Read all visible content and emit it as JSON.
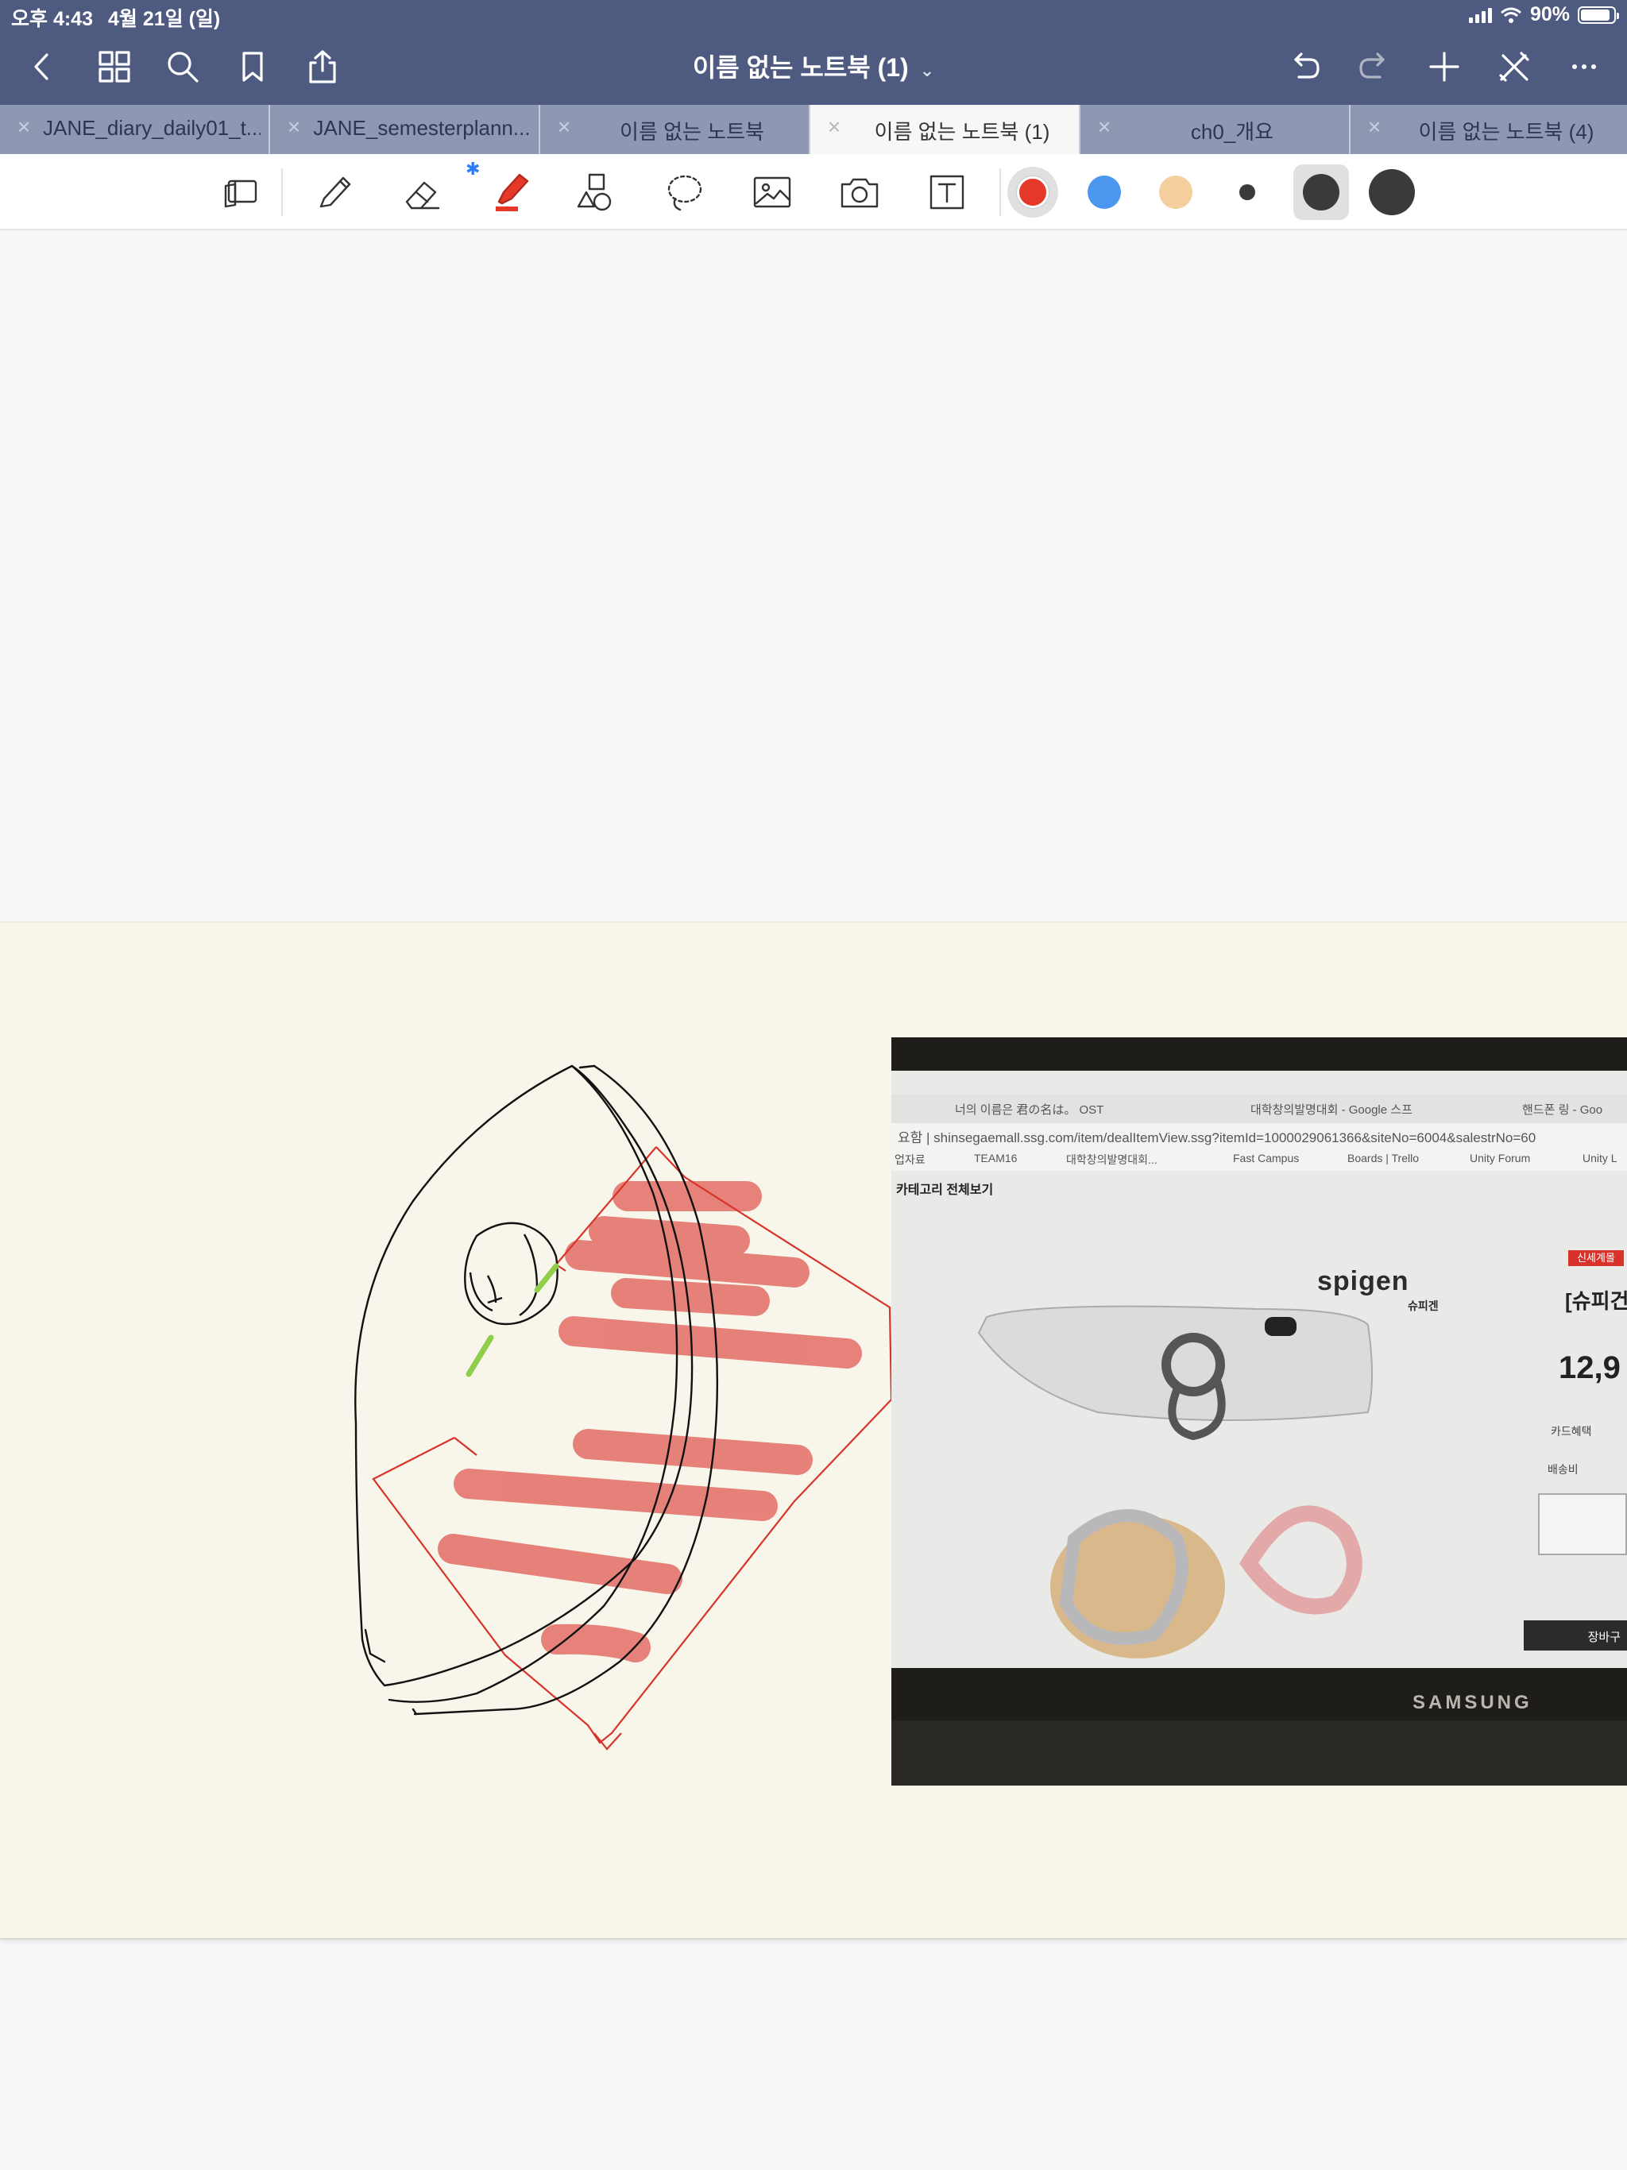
{
  "status_bar": {
    "time": "오후 4:43",
    "date": "4월 21일 (일)",
    "battery": "90%",
    "battery_level": 0.9
  },
  "nav": {
    "title": "이름 없는 노트북 (1)",
    "title_chevron": "⌄"
  },
  "tabs": [
    {
      "label": "JANE_diary_daily01_t...",
      "close": "×",
      "active": false
    },
    {
      "label": "JANE_semesterplann...",
      "close": "×",
      "active": false
    },
    {
      "label": "이름 없는 노트북",
      "close": "×",
      "active": false
    },
    {
      "label": "이름 없는 노트북 (1)",
      "close": "×",
      "active": true
    },
    {
      "label": "ch0_개요",
      "close": "×",
      "active": false
    },
    {
      "label": "이름 없는 노트북 (4)",
      "close": "×",
      "active": false
    }
  ],
  "toolbar": {
    "tools": [
      "read-only-mode-icon",
      "pen-icon",
      "eraser-icon",
      "highlighter-icon",
      "shapes-icon",
      "lasso-icon",
      "image-icon",
      "camera-icon",
      "text-box-icon"
    ],
    "selected_tool": "highlighter",
    "bluetooth_mark": "✱",
    "colors": [
      "#e53828",
      "#4b97f0",
      "#f5cf9e"
    ],
    "selected_color": "#e53828",
    "stroke_sizes": [
      "small",
      "medium",
      "large"
    ],
    "selected_size": "medium"
  },
  "photo": {
    "browser_tabs": [
      "너의 이름은 君の名は。 OST",
      "대학창의발명대회 - Google 스프",
      "핸드폰 링 - Goo"
    ],
    "url": "요함 | shinsegaemall.ssg.com/item/dealItemView.ssg?itemId=1000029061366&siteNo=6004&salestrNo=60",
    "bookmarks": [
      "업자료",
      "TEAM16",
      "대학창의발명대회...",
      "Fast Campus",
      "Boards | Trello",
      "Unity Forum",
      "Unity L"
    ],
    "category": "카테고리 전체보기",
    "brand": "spigen",
    "brand_sub": "슈피겐",
    "badge": "신세계몰",
    "product_title": "[슈피건",
    "price": "12,9",
    "card_label": "카드혜택",
    "shipping_label": "배송비",
    "cart_label": "장바구",
    "laptop_brand": "SAMSUNG"
  }
}
